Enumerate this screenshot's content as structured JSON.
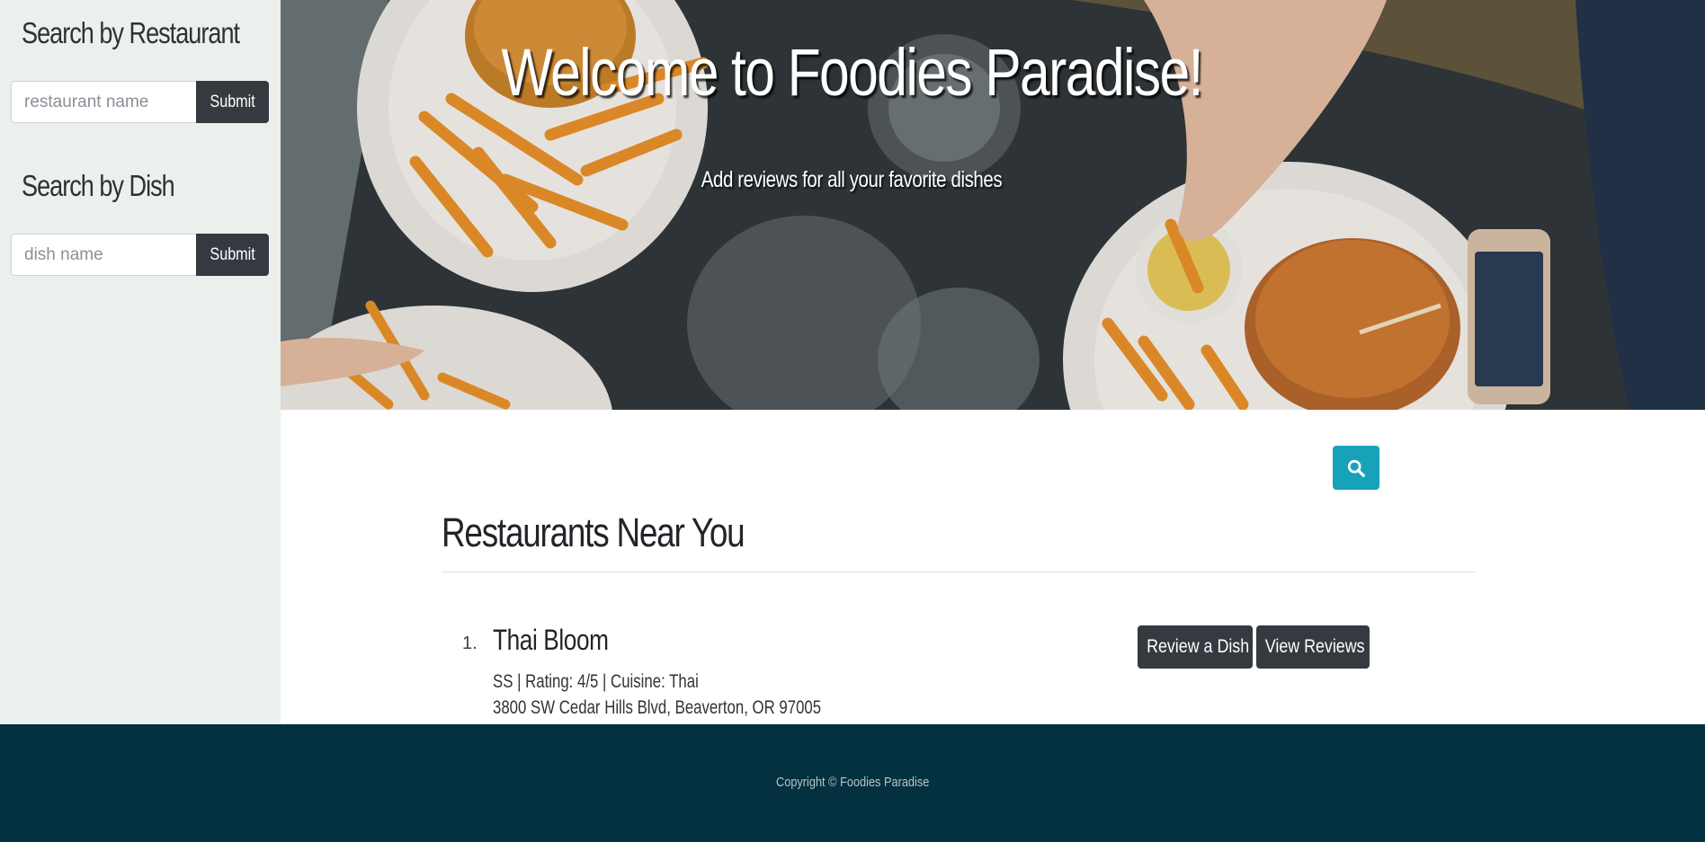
{
  "sidebar": {
    "restaurant_search": {
      "heading": "Search by Restaurant",
      "placeholder": "restaurant name",
      "submit_label": "Submit"
    },
    "dish_search": {
      "heading": "Search by Dish",
      "placeholder": "dish name",
      "submit_label": "Submit"
    }
  },
  "hero": {
    "title": "Welcome to Foodies Paradise!",
    "subtitle": "Add reviews for all your favorite dishes"
  },
  "main": {
    "section_title": "Restaurants Near You",
    "restaurants": [
      {
        "index": "1.",
        "name": "Thai Bloom",
        "meta": "SS | Rating: 4/5 | Cuisine: Thai",
        "address": "3800 SW Cedar Hills Blvd, Beaverton, OR 97005",
        "review_label": "Review a Dish",
        "view_label": "View Reviews"
      }
    ]
  },
  "footer": {
    "copyright": "Copyright © Foodies Paradise"
  },
  "colors": {
    "sidebar_bg": "#ebf0ec",
    "button_dark": "#343a40",
    "search_accent": "#17a2b8",
    "footer_bg": "#04313f"
  },
  "icons": {
    "search_button": "search-icon"
  }
}
